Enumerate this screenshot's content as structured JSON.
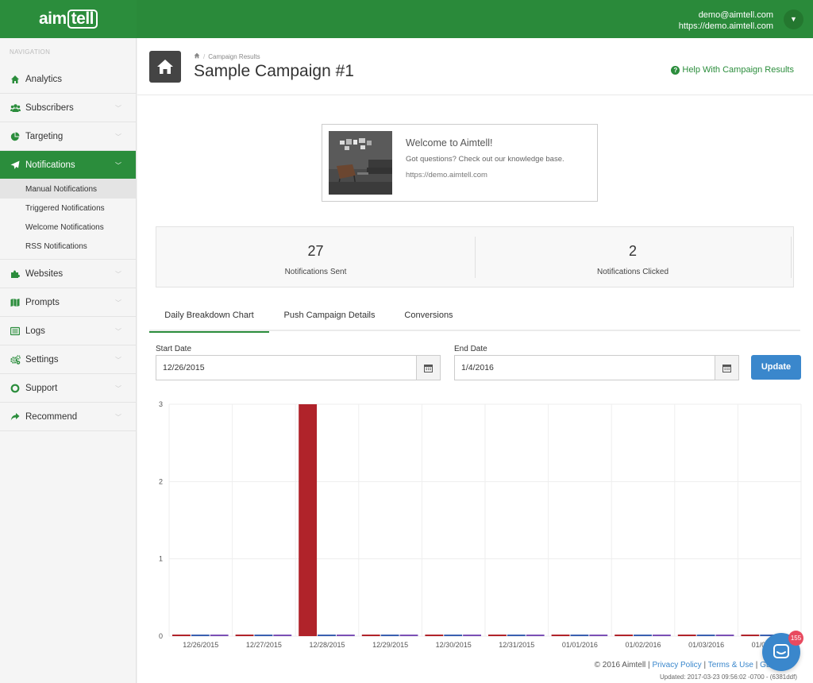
{
  "brand": {
    "logo_prefix": "aim",
    "logo_suffix": "tell",
    "color": "#2b8d3c"
  },
  "user": {
    "email": "demo@aimtell.com",
    "site": "https://demo.aimtell.com"
  },
  "sidebar": {
    "heading": "NAVIGATION",
    "items": [
      {
        "label": "Analytics",
        "icon": "home-icon"
      },
      {
        "label": "Subscribers",
        "icon": "users-icon"
      },
      {
        "label": "Targeting",
        "icon": "pie-chart-icon"
      },
      {
        "label": "Notifications",
        "icon": "paper-plane-icon"
      },
      {
        "label": "Websites",
        "icon": "puzzle-icon"
      },
      {
        "label": "Prompts",
        "icon": "map-icon"
      },
      {
        "label": "Logs",
        "icon": "list-icon"
      },
      {
        "label": "Settings",
        "icon": "gears-icon"
      },
      {
        "label": "Support",
        "icon": "life-ring-icon"
      },
      {
        "label": "Recommend",
        "icon": "share-icon"
      }
    ],
    "sub_items": [
      "Manual Notifications",
      "Triggered Notifications",
      "Welcome Notifications",
      "RSS Notifications"
    ]
  },
  "header": {
    "breadcrumb": "Campaign Results",
    "title": "Sample Campaign #1",
    "help": "Help With Campaign Results"
  },
  "welcome": {
    "title": "Welcome to Aimtell!",
    "text": "Got questions? Check out our knowledge base.",
    "url": "https://demo.aimtell.com"
  },
  "stats": [
    {
      "value": "27",
      "label": "Notifications Sent"
    },
    {
      "value": "2",
      "label": "Notifications Clicked"
    }
  ],
  "tabs": [
    "Daily Breakdown Chart",
    "Push Campaign Details",
    "Conversions"
  ],
  "filters": {
    "start_label": "Start Date",
    "start_value": "12/26/2015",
    "end_label": "End Date",
    "end_value": "1/4/2016",
    "update_label": "Update"
  },
  "chart_data": {
    "type": "bar",
    "categories": [
      "12/26/2015",
      "12/27/2015",
      "12/28/2015",
      "12/29/2015",
      "12/30/2015",
      "12/31/2015",
      "01/01/2016",
      "01/02/2016",
      "01/03/2016",
      "01/04/2016"
    ],
    "series": [
      {
        "color": "#b0232a",
        "values": [
          0,
          0,
          3,
          0,
          0,
          0,
          0,
          0,
          0,
          0
        ]
      },
      {
        "color": "#3a5fb0",
        "values": [
          0,
          0,
          0,
          0,
          0,
          0,
          0,
          0,
          0,
          0
        ]
      },
      {
        "color": "#7b4fb5",
        "values": [
          0,
          0,
          0,
          0,
          0,
          0,
          0,
          0,
          0,
          0
        ]
      }
    ],
    "yticks": [
      "0",
      "1",
      "2",
      "3"
    ],
    "ylim": [
      0,
      3
    ],
    "grid": true
  },
  "footer": {
    "copyright": "© 2016 Aimtell |",
    "privacy": "Privacy Policy",
    "sep1": "|",
    "terms": "Terms & Use",
    "sep2": "|",
    "extra": "GDPR",
    "updated": "Updated: 2017-03-23 09:56:02 -0700 - (6381ddf)"
  },
  "chat": {
    "badge": "155"
  }
}
